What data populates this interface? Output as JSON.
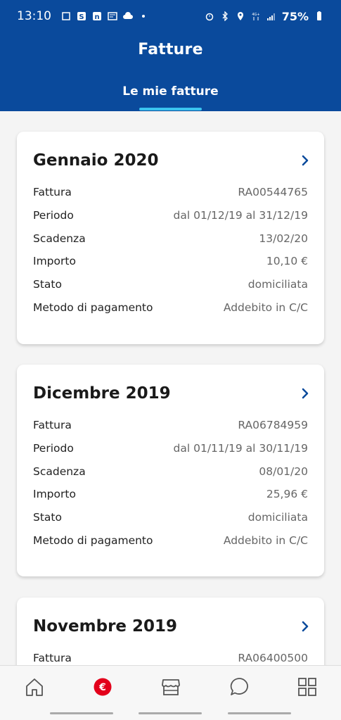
{
  "status": {
    "time": "13:10",
    "battery": "75%"
  },
  "header": {
    "title": "Fatture",
    "tab": "Le mie fatture"
  },
  "colors": {
    "header_bg": "#0a4a9c",
    "tab_indicator": "#3ac4ef",
    "euro_icon": "#e3001b"
  },
  "cards": [
    {
      "month": "Gennaio 2020",
      "rows": [
        {
          "label": "Fattura",
          "value": "RA00544765"
        },
        {
          "label": "Periodo",
          "value": "dal 01/12/19 al 31/12/19"
        },
        {
          "label": "Scadenza",
          "value": "13/02/20"
        },
        {
          "label": "Importo",
          "value": "10,10 €"
        },
        {
          "label": "Stato",
          "value": "domiciliata"
        },
        {
          "label": "Metodo di pagamento",
          "value": "Addebito in C/C"
        }
      ]
    },
    {
      "month": "Dicembre 2019",
      "rows": [
        {
          "label": "Fattura",
          "value": "RA06784959"
        },
        {
          "label": "Periodo",
          "value": "dal 01/11/19 al 30/11/19"
        },
        {
          "label": "Scadenza",
          "value": "08/01/20"
        },
        {
          "label": "Importo",
          "value": "25,96 €"
        },
        {
          "label": "Stato",
          "value": "domiciliata"
        },
        {
          "label": "Metodo di pagamento",
          "value": "Addebito in C/C"
        }
      ]
    },
    {
      "month": "Novembre 2019",
      "rows": [
        {
          "label": "Fattura",
          "value": "RA06400500"
        }
      ]
    }
  ],
  "bottom_nav": [
    {
      "icon": "home-icon"
    },
    {
      "icon": "euro-icon"
    },
    {
      "icon": "store-icon"
    },
    {
      "icon": "chat-icon"
    },
    {
      "icon": "grid-icon"
    }
  ]
}
